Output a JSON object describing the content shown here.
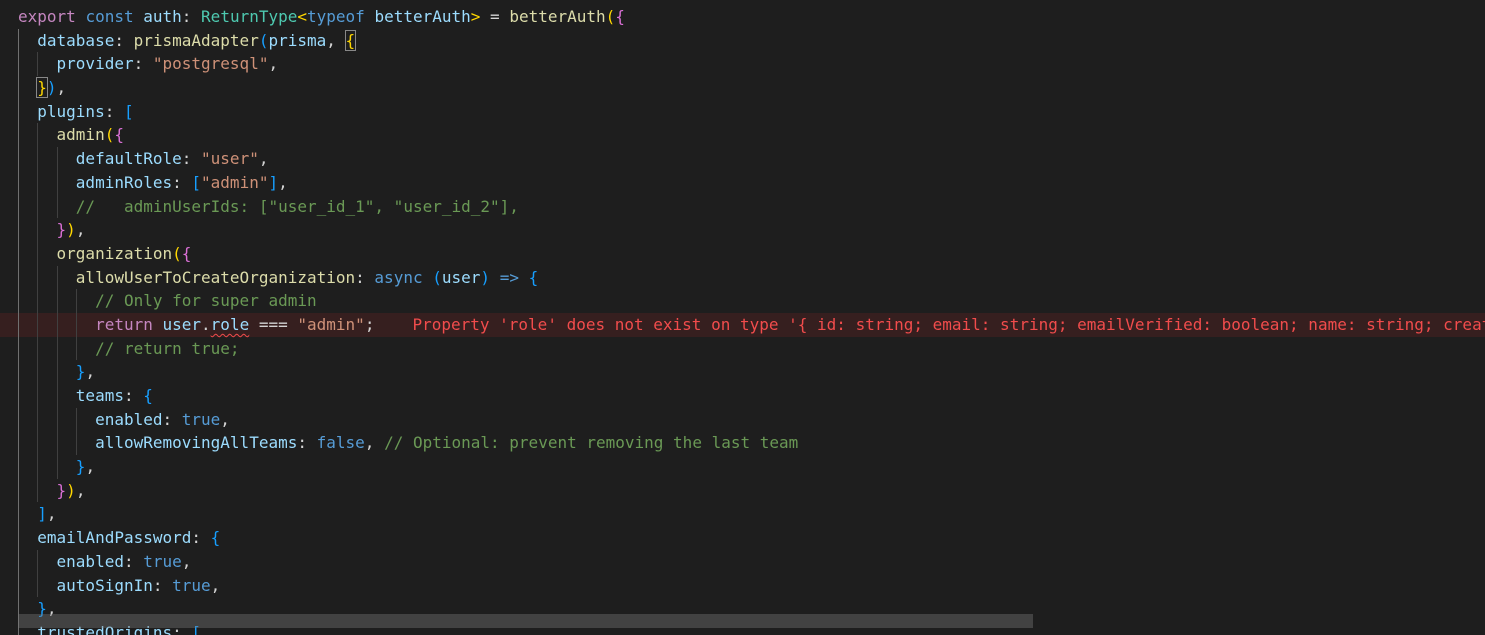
{
  "editor": {
    "colors": {
      "background": "#1e1e1e",
      "keyword": "#569cd6",
      "control_keyword": "#c586c0",
      "function": "#dcdcaa",
      "type": "#4ec9b0",
      "variable": "#9cdcfe",
      "string": "#ce9178",
      "comment": "#6a9955",
      "error": "#f14c4c"
    },
    "lines": [
      {
        "indent": 0,
        "tokens": [
          {
            "t": "export",
            "c": "ctl"
          },
          {
            "t": " ",
            "c": "pn"
          },
          {
            "t": "const",
            "c": "kw"
          },
          {
            "t": " ",
            "c": "pn"
          },
          {
            "t": "auth",
            "c": "var"
          },
          {
            "t": ": ",
            "c": "pn"
          },
          {
            "t": "ReturnType",
            "c": "ty"
          },
          {
            "t": "<",
            "c": "b1"
          },
          {
            "t": "typeof",
            "c": "kw"
          },
          {
            "t": " ",
            "c": "pn"
          },
          {
            "t": "betterAuth",
            "c": "var"
          },
          {
            "t": ">",
            "c": "b1"
          },
          {
            "t": " = ",
            "c": "pn"
          },
          {
            "t": "betterAuth",
            "c": "fn"
          },
          {
            "t": "(",
            "c": "b1"
          },
          {
            "t": "{",
            "c": "b2"
          }
        ]
      },
      {
        "indent": 2,
        "tokens": [
          {
            "t": "database",
            "c": "var"
          },
          {
            "t": ": ",
            "c": "pn"
          },
          {
            "t": "prismaAdapter",
            "c": "fn"
          },
          {
            "t": "(",
            "c": "b3"
          },
          {
            "t": "prisma",
            "c": "var"
          },
          {
            "t": ", ",
            "c": "pn"
          },
          {
            "t": "{",
            "c": "b1 bm"
          }
        ]
      },
      {
        "indent": 4,
        "tokens": [
          {
            "t": "provider",
            "c": "var"
          },
          {
            "t": ": ",
            "c": "pn"
          },
          {
            "t": "\"postgresql\"",
            "c": "str"
          },
          {
            "t": ",",
            "c": "pn"
          }
        ]
      },
      {
        "indent": 2,
        "tokens": [
          {
            "t": "}",
            "c": "b1 bm"
          },
          {
            "t": ")",
            "c": "b3"
          },
          {
            "t": ",",
            "c": "pn"
          }
        ]
      },
      {
        "indent": 2,
        "tokens": [
          {
            "t": "plugins",
            "c": "var"
          },
          {
            "t": ": ",
            "c": "pn"
          },
          {
            "t": "[",
            "c": "b3"
          }
        ]
      },
      {
        "indent": 4,
        "tokens": [
          {
            "t": "admin",
            "c": "fn"
          },
          {
            "t": "(",
            "c": "b1"
          },
          {
            "t": "{",
            "c": "b2"
          }
        ]
      },
      {
        "indent": 6,
        "tokens": [
          {
            "t": "defaultRole",
            "c": "var"
          },
          {
            "t": ": ",
            "c": "pn"
          },
          {
            "t": "\"user\"",
            "c": "str"
          },
          {
            "t": ",",
            "c": "pn"
          }
        ]
      },
      {
        "indent": 6,
        "tokens": [
          {
            "t": "adminRoles",
            "c": "var"
          },
          {
            "t": ": ",
            "c": "pn"
          },
          {
            "t": "[",
            "c": "b3"
          },
          {
            "t": "\"admin\"",
            "c": "str"
          },
          {
            "t": "]",
            "c": "b3"
          },
          {
            "t": ",",
            "c": "pn"
          }
        ]
      },
      {
        "indent": 6,
        "tokens": [
          {
            "t": "//   adminUserIds: [\"user_id_1\", \"user_id_2\"],",
            "c": "cm"
          }
        ]
      },
      {
        "indent": 4,
        "tokens": [
          {
            "t": "}",
            "c": "b2"
          },
          {
            "t": ")",
            "c": "b1"
          },
          {
            "t": ",",
            "c": "pn"
          }
        ]
      },
      {
        "indent": 4,
        "tokens": [
          {
            "t": "organization",
            "c": "fn"
          },
          {
            "t": "(",
            "c": "b1"
          },
          {
            "t": "{",
            "c": "b2"
          }
        ]
      },
      {
        "indent": 6,
        "tokens": [
          {
            "t": "allowUserToCreateOrganization",
            "c": "fn"
          },
          {
            "t": ": ",
            "c": "pn"
          },
          {
            "t": "async",
            "c": "kw"
          },
          {
            "t": " ",
            "c": "pn"
          },
          {
            "t": "(",
            "c": "b3"
          },
          {
            "t": "user",
            "c": "var"
          },
          {
            "t": ")",
            "c": "b3"
          },
          {
            "t": " ",
            "c": "pn"
          },
          {
            "t": "=>",
            "c": "kw"
          },
          {
            "t": " ",
            "c": "pn"
          },
          {
            "t": "{",
            "c": "b3"
          }
        ]
      },
      {
        "indent": 8,
        "tokens": [
          {
            "t": "// Only for super admin",
            "c": "cm"
          }
        ]
      },
      {
        "indent": 8,
        "error_line": true,
        "tokens": [
          {
            "t": "return",
            "c": "ctl"
          },
          {
            "t": " ",
            "c": "pn"
          },
          {
            "t": "user",
            "c": "var"
          },
          {
            "t": ".",
            "c": "pn"
          },
          {
            "t": "role",
            "c": "var squig"
          },
          {
            "t": " === ",
            "c": "pn"
          },
          {
            "t": "\"admin\"",
            "c": "str"
          },
          {
            "t": ";",
            "c": "pn"
          }
        ],
        "inline_error": "Property 'role' does not exist on type '{ id: string; email: string; emailVerified: boolean; name: string; createdAt: Date; updatedAt: Date; image?: string | null | undefined; }'."
      },
      {
        "indent": 8,
        "tokens": [
          {
            "t": "// return true;",
            "c": "cm"
          }
        ]
      },
      {
        "indent": 6,
        "tokens": [
          {
            "t": "}",
            "c": "b3"
          },
          {
            "t": ",",
            "c": "pn"
          }
        ]
      },
      {
        "indent": 6,
        "tokens": [
          {
            "t": "teams",
            "c": "var"
          },
          {
            "t": ": ",
            "c": "pn"
          },
          {
            "t": "{",
            "c": "b3"
          }
        ]
      },
      {
        "indent": 8,
        "tokens": [
          {
            "t": "enabled",
            "c": "var"
          },
          {
            "t": ": ",
            "c": "pn"
          },
          {
            "t": "true",
            "c": "kw"
          },
          {
            "t": ",",
            "c": "pn"
          }
        ]
      },
      {
        "indent": 8,
        "tokens": [
          {
            "t": "allowRemovingAllTeams",
            "c": "var"
          },
          {
            "t": ": ",
            "c": "pn"
          },
          {
            "t": "false",
            "c": "kw"
          },
          {
            "t": ", ",
            "c": "pn"
          },
          {
            "t": "// Optional: prevent removing the last team",
            "c": "cm"
          }
        ]
      },
      {
        "indent": 6,
        "tokens": [
          {
            "t": "}",
            "c": "b3"
          },
          {
            "t": ",",
            "c": "pn"
          }
        ]
      },
      {
        "indent": 4,
        "tokens": [
          {
            "t": "}",
            "c": "b2"
          },
          {
            "t": ")",
            "c": "b1"
          },
          {
            "t": ",",
            "c": "pn"
          }
        ]
      },
      {
        "indent": 2,
        "tokens": [
          {
            "t": "]",
            "c": "b3"
          },
          {
            "t": ",",
            "c": "pn"
          }
        ]
      },
      {
        "indent": 2,
        "tokens": [
          {
            "t": "emailAndPassword",
            "c": "var"
          },
          {
            "t": ": ",
            "c": "pn"
          },
          {
            "t": "{",
            "c": "b3"
          }
        ]
      },
      {
        "indent": 4,
        "tokens": [
          {
            "t": "enabled",
            "c": "var"
          },
          {
            "t": ": ",
            "c": "pn"
          },
          {
            "t": "true",
            "c": "kw"
          },
          {
            "t": ",",
            "c": "pn"
          }
        ]
      },
      {
        "indent": 4,
        "tokens": [
          {
            "t": "autoSignIn",
            "c": "var"
          },
          {
            "t": ": ",
            "c": "pn"
          },
          {
            "t": "true",
            "c": "kw"
          },
          {
            "t": ",",
            "c": "pn"
          }
        ]
      },
      {
        "indent": 2,
        "tokens": [
          {
            "t": "}",
            "c": "b3"
          },
          {
            "t": ",",
            "c": "pn"
          }
        ]
      },
      {
        "indent": 2,
        "tokens": [
          {
            "t": "trustedOrigins",
            "c": "var"
          },
          {
            "t": ": ",
            "c": "pn"
          },
          {
            "t": "[",
            "c": "b3"
          }
        ]
      }
    ]
  }
}
